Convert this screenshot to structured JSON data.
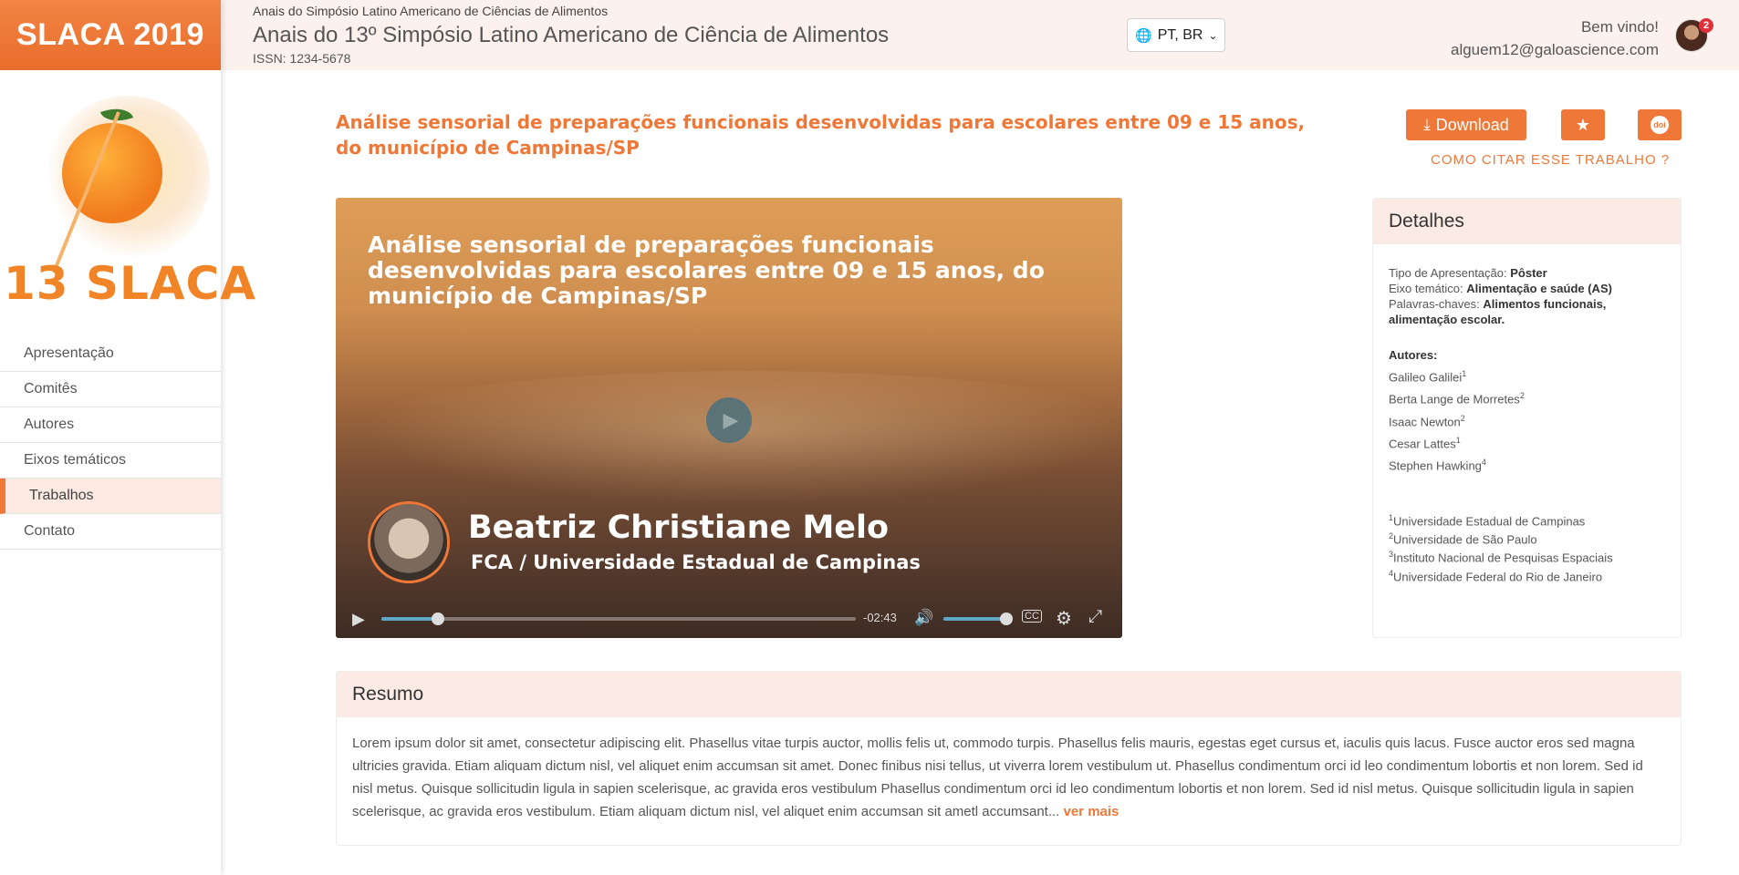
{
  "sidebar": {
    "brand": "SLACA 2019",
    "logo_text": "13 SLACA",
    "items": [
      {
        "label": "Apresentação"
      },
      {
        "label": "Comitês"
      },
      {
        "label": "Autores"
      },
      {
        "label": "Eixos temáticos"
      },
      {
        "label": "Trabalhos",
        "active": true
      },
      {
        "label": "Contato"
      }
    ]
  },
  "header": {
    "sup_title": "Anais do Simpósio Latino Americano de Ciências de Alimentos",
    "title": "Anais do 13º Simpósio Latino Americano de Ciência de Alimentos",
    "issn": "ISSN: 1234-5678",
    "language": "PT, BR",
    "welcome": "Bem vindo!",
    "email": "alguem12@galoascience.com",
    "notifications": "2"
  },
  "paper": {
    "title": "Análise sensorial de preparações funcionais desenvolvidas para escolares entre 09 e 15 anos, do município de Campinas/SP",
    "download_label": "Download",
    "doi_label": "doi",
    "cite_label": "COMO CITAR ESSE TRABALHO ?"
  },
  "video": {
    "heading": "Análise sensorial de preparações funcionais desenvolvidas para escolares entre 09 e 15 anos, do município de Campinas/SP",
    "speaker_name": "Beatriz Christiane Melo",
    "speaker_affiliation": "FCA / Universidade Estadual de Campinas",
    "time_remaining": "-02:43",
    "progress": 0.12,
    "volume": 0.9,
    "cc_label": "CC"
  },
  "details": {
    "title": "Detalhes",
    "presentation_type_label": "Tipo de Apresentação:",
    "presentation_type": "Pôster",
    "axis_label": "Eixo temático:",
    "axis": "Alimentação e saúde (AS)",
    "keywords_label": "Palavras-chaves:",
    "keywords": "Alimentos funcionais, alimentação escolar.",
    "authors_label": "Autores:",
    "authors": [
      {
        "name": "Galileo Galilei",
        "aff": "1"
      },
      {
        "name": "Berta Lange de Morretes",
        "aff": "2"
      },
      {
        "name": "Isaac Newton",
        "aff": "2"
      },
      {
        "name": "Cesar Lattes",
        "aff": "1"
      },
      {
        "name": "Stephen Hawking",
        "aff": "4"
      }
    ],
    "affiliations": [
      {
        "num": "1",
        "name": "Universidade Estadual de Campinas"
      },
      {
        "num": "2",
        "name": "Universidade de São Paulo"
      },
      {
        "num": "3",
        "name": "Instituto Nacional de Pesquisas Espaciais"
      },
      {
        "num": "4",
        "name": "Universidade Federal do Rio de Janeiro"
      }
    ]
  },
  "resumo": {
    "title": "Resumo",
    "text": "Lorem ipsum dolor sit amet, consectetur adipiscing elit. Phasellus vitae turpis auctor, mollis felis ut, commodo turpis. Phasellus felis mauris, egestas eget cursus et, iaculis quis lacus. Fusce auctor eros sed magna ultricies gravida. Etiam aliquam dictum nisl, vel aliquet enim accumsan sit amet. Donec finibus nisi tellus, ut viverra lorem vestibulum ut. Phasellus condimentum orci id leo condimentum lobortis et non lorem. Sed id nisl metus. Quisque sollicitudin ligula in sapien scelerisque, ac gravida eros vestibulum Phasellus condimentum orci id leo condimentum lobortis et non lorem. Sed id nisl metus. Quisque sollicitudin ligula in sapien scelerisque, ac gravida eros vestibulum. Etiam aliquam dictum nisl, vel aliquet enim accumsan sit ametl accumsant...",
    "more_label": "ver mais"
  },
  "colors": {
    "accent": "#ef7838",
    "panel_head": "#fcebe5",
    "header_bg": "#fcf1ec"
  }
}
